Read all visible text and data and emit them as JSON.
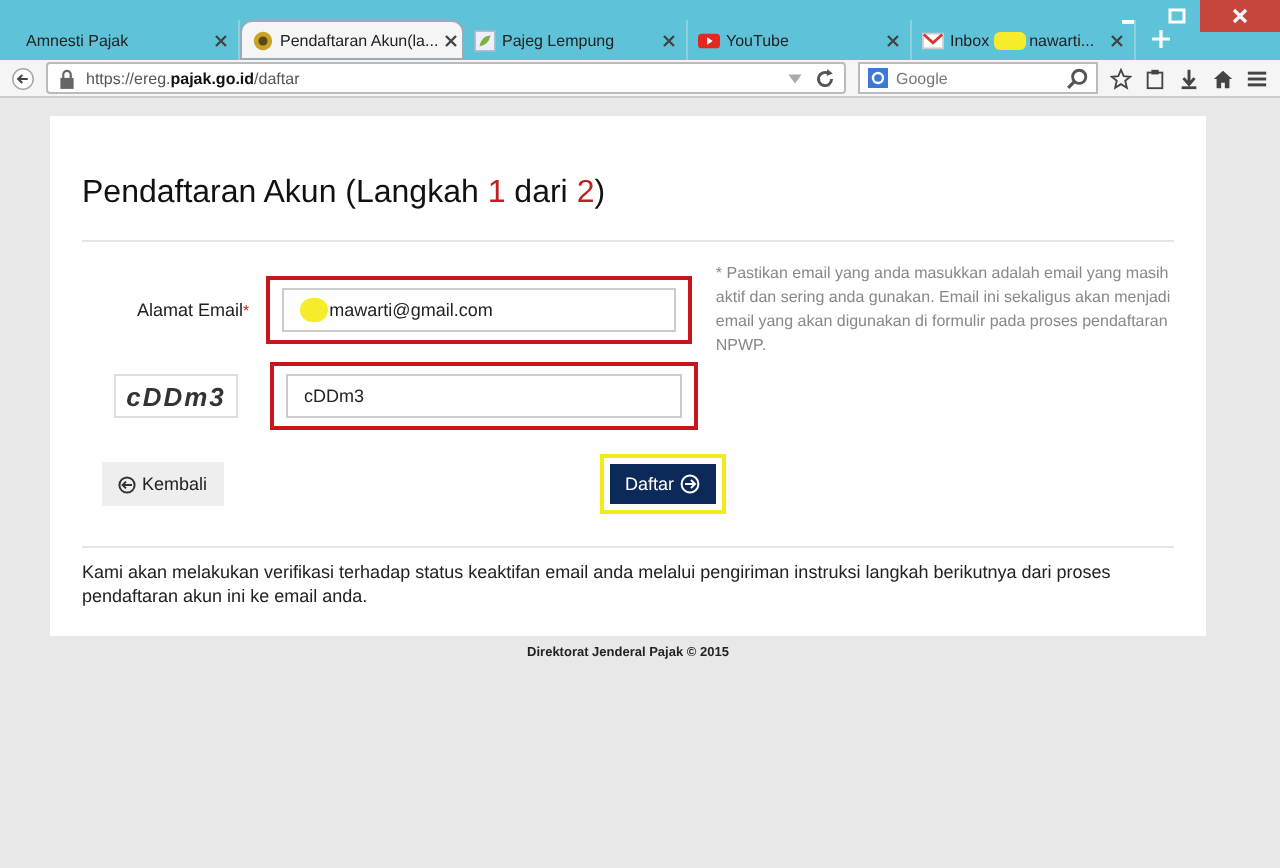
{
  "browser": {
    "tabs": [
      {
        "title": "Amnesti Pajak",
        "selected": false
      },
      {
        "title": "Pendaftaran Akun(la...",
        "selected": true
      },
      {
        "title": "Pajeg Lempung",
        "selected": false
      },
      {
        "title": "YouTube",
        "selected": false
      },
      {
        "title": "Inbox",
        "title_end": "nawarti...",
        "selected": false,
        "redacted": true
      }
    ],
    "url_prefix": "https://ereg.",
    "url_domain": "pajak.go.id",
    "url_path": "/daftar",
    "search_placeholder": "Google"
  },
  "page": {
    "heading_parts": [
      "Pendaftaran Akun  (Langkah ",
      "1",
      " dari ",
      "2",
      ")"
    ],
    "email_label": "Alamat Email",
    "required_mark": "*",
    "email_value": "mawarti@gmail.com",
    "email_redacted": true,
    "hint": "* Pastikan email yang anda masukkan adalah email yang masih aktif dan sering anda gunakan. Email ini sekaligus akan menjadi email yang akan digunakan di formulir pada proses pendaftaran NPWP.",
    "captcha": "cDDm3",
    "captcha_value": "cDDm3",
    "back_button": "Kembali",
    "submit_button": "Daftar",
    "note": "Kami akan melakukan verifikasi terhadap status keaktifan email anda melalui pengiriman instruksi langkah berikutnya dari proses pendaftaran akun ini ke email anda.",
    "footer": "Direktorat Jenderal Pajak © 2015"
  }
}
